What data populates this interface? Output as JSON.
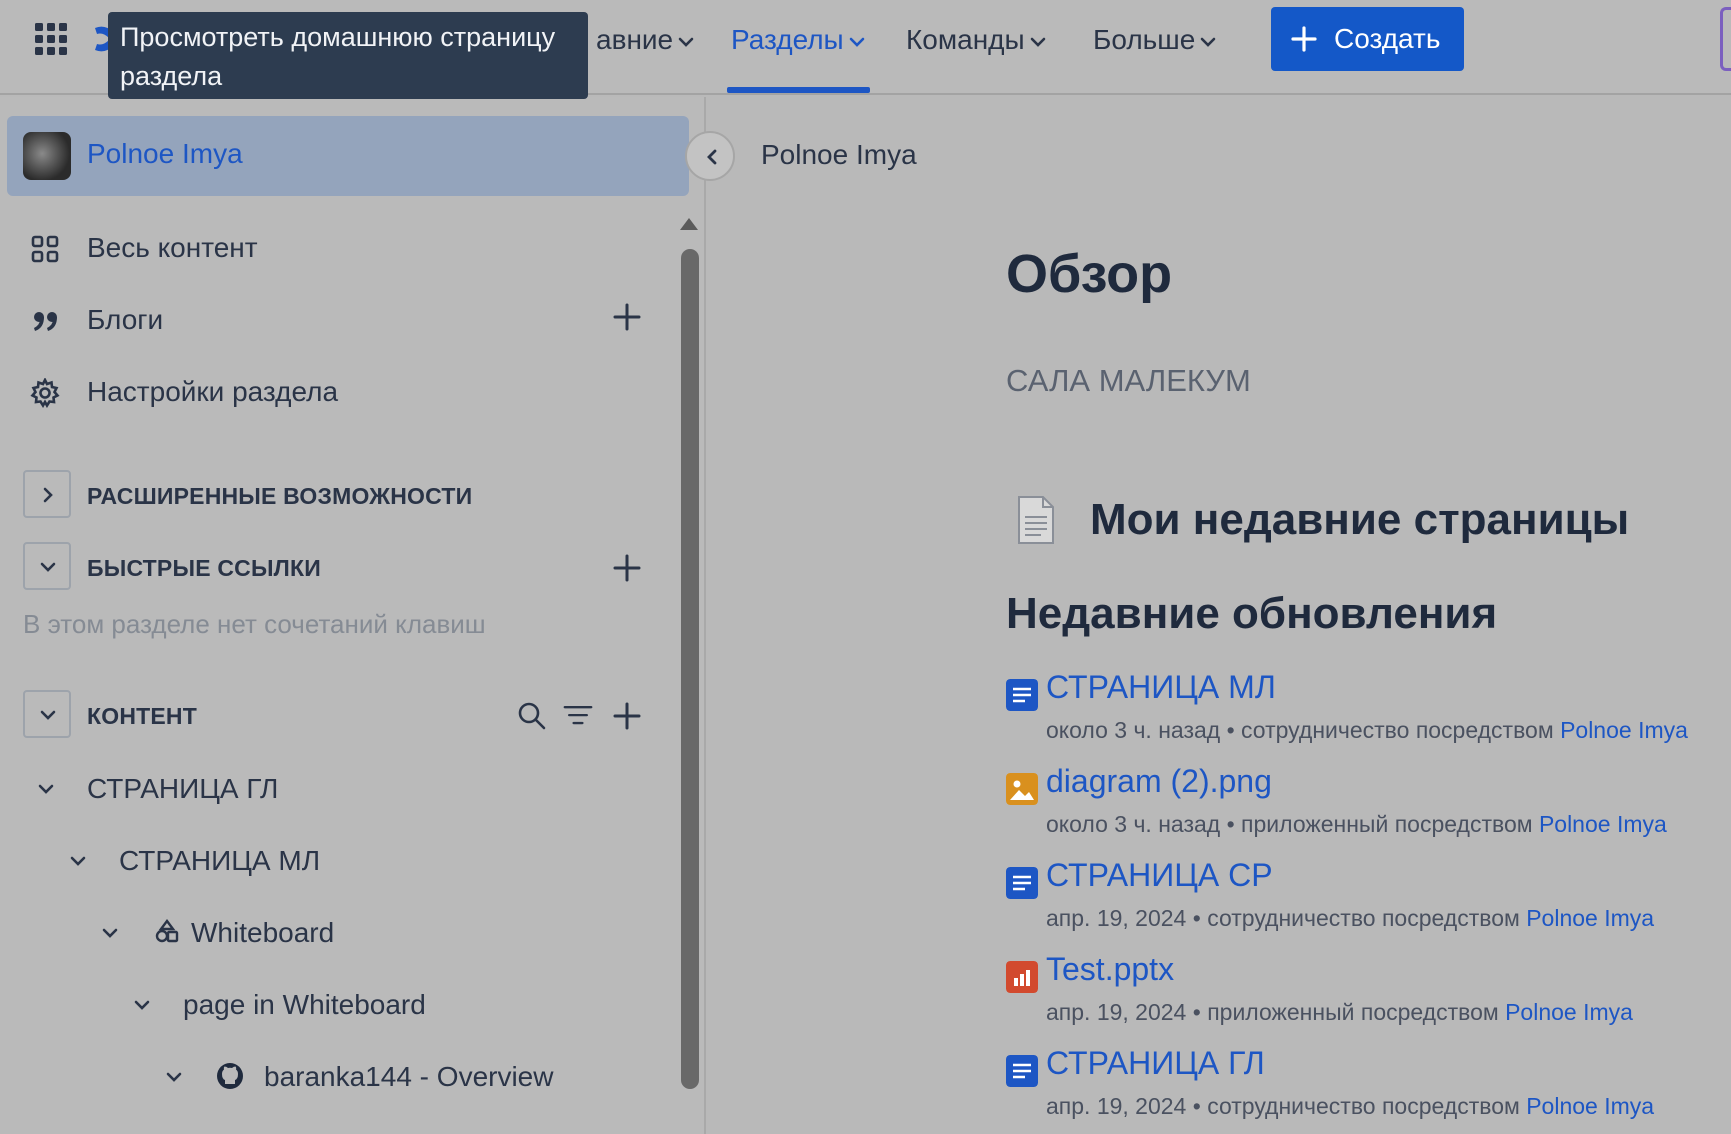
{
  "topnav": {
    "items": [
      {
        "label": "авние"
      },
      {
        "label": "Разделы"
      },
      {
        "label": "Команды"
      },
      {
        "label": "Больше"
      }
    ],
    "create_label": "Создать"
  },
  "tooltip": {
    "text": "Просмотреть домашнюю страницу раздела"
  },
  "sidebar": {
    "space_name": "Polnoe Imya",
    "items": [
      {
        "label": "Весь контент",
        "icon": "grid-icon"
      },
      {
        "label": "Блоги",
        "icon": "quote-icon"
      },
      {
        "label": "Настройки раздела",
        "icon": "gear-icon"
      }
    ],
    "sections": {
      "advanced": "РАСШИРЕННЫЕ ВОЗМОЖНОСТИ",
      "shortcuts": "БЫСТРЫЕ ССЫЛКИ",
      "shortcuts_empty": "В этом разделе нет сочетаний клавиш",
      "content": "КОНТЕНТ"
    },
    "tree": [
      {
        "label": "СТРАНИЦА ГЛ"
      },
      {
        "label": "СТРАНИЦА МЛ"
      },
      {
        "label": "Whiteboard",
        "icon": "whiteboard-icon"
      },
      {
        "label": "page in Whiteboard"
      },
      {
        "label": "baranka144 - Overview",
        "icon": "github-icon"
      }
    ]
  },
  "main": {
    "breadcrumb": "Polnoe Imya",
    "title": "Обзор",
    "subtitle": "САЛА МАЛЕКУМ",
    "recent_pages_title": "Мои недавние страницы",
    "updates_title": "Недавние обновления",
    "updates": [
      {
        "title": "СТРАНИЦА МЛ",
        "time": "около 3 ч. назад",
        "action": "сотрудничество посредством",
        "author": "Polnoe Imya",
        "type": "page",
        "color": "#1d56c4"
      },
      {
        "title": "diagram (2).png",
        "time": "около 3 ч. назад",
        "action": "приложенный посредством",
        "author": "Polnoe Imya",
        "type": "image",
        "color": "#d9901e"
      },
      {
        "title": "СТРАНИЦА СР",
        "time": "апр. 19, 2024",
        "action": "сотрудничество посредством",
        "author": "Polnoe Imya",
        "type": "page",
        "color": "#1d56c4"
      },
      {
        "title": "Test.pptx",
        "time": "апр. 19, 2024",
        "action": "приложенный посредством",
        "author": "Polnoe Imya",
        "type": "presentation",
        "color": "#d24a2e"
      },
      {
        "title": "СТРАНИЦА ГЛ",
        "time": "апр. 19, 2024",
        "action": "сотрудничество посредством",
        "author": "Polnoe Imya",
        "type": "page",
        "color": "#1d56c4"
      }
    ]
  },
  "colors": {
    "accent": "#1d56c4",
    "create_button": "#1458c8",
    "tooltip_bg": "#2d3c50"
  }
}
